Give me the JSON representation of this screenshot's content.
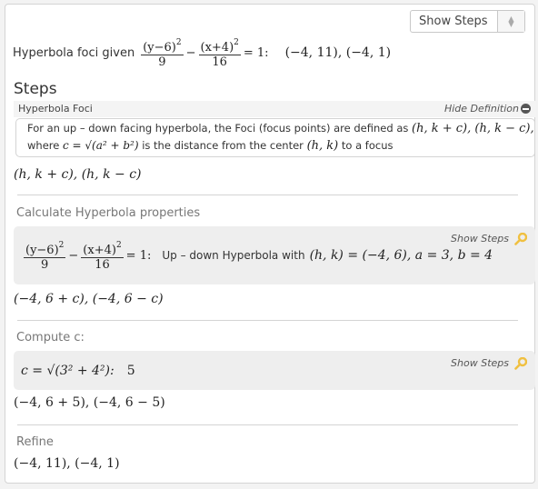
{
  "dropdown": {
    "selected": "Show Steps"
  },
  "header": {
    "prefix": "Hyperbola foci given",
    "frac1_num": "(y−6)",
    "frac1_den": "9",
    "minus": "−",
    "frac2_num": "(x+4)",
    "frac2_den": "16",
    "equals": "= 1:",
    "result": "(−4, 11), (−4, 1)"
  },
  "steps_title": "Steps",
  "definition": {
    "title": "Hyperbola Foci",
    "toggle_label": "Hide Definition",
    "toggle_icon": "minus-circle-icon",
    "line1_text": "For an up – down facing hyperbola, the Foci (focus points) are defined as",
    "line1_math": "(h, k + c), (h, k − c),",
    "line2_where": "where",
    "line2_formula": "c = √(a² + b²)",
    "line2_text": "is the distance from the center",
    "line2_center": "(h, k)",
    "line2_end": "to a focus"
  },
  "formula_foci": "(h, k + c), (h, k − c)",
  "sections": [
    {
      "title": "Calculate Hyperbola properties",
      "show_steps": "Show Steps",
      "icon": "key-icon",
      "frac1_num": "(y−6)",
      "frac1_den": "9",
      "frac2_num": "(x+4)",
      "frac2_den": "16",
      "equals": "= 1:",
      "description": "Up – down Hyperbola with",
      "params": "(h, k) = (−4, 6), a = 3, b = 4",
      "result": "(−4, 6 + c), (−4, 6 − c)"
    },
    {
      "title": "Compute c:",
      "show_steps": "Show Steps",
      "icon": "key-icon",
      "formula": "c = √(3² + 4²):",
      "value": "5",
      "result": "(−4, 6 + 5), (−4, 6 − 5)"
    },
    {
      "title": "Refine",
      "result": "(−4, 11), (−4, 1)"
    }
  ],
  "colors": {
    "key_icon": "#f0c040",
    "step_box_bg": "#eeeeee"
  }
}
